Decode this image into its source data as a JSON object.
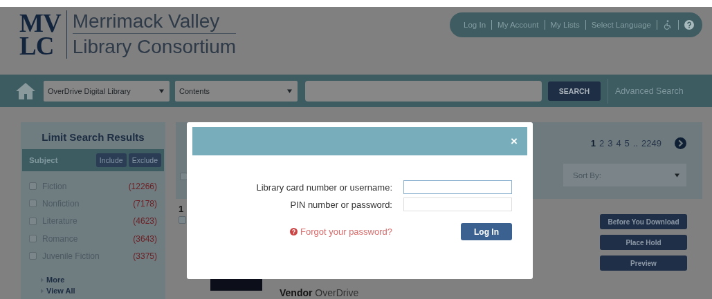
{
  "header": {
    "logo_letters": [
      "MV",
      "LC"
    ],
    "logo_name": [
      "Merrimack Valley",
      "Library Consortium"
    ]
  },
  "top_links": [
    "Log In",
    "My Account",
    "My Lists",
    "Select Language"
  ],
  "search_bar": {
    "library_select": "OverDrive Digital Library",
    "scope_select": "Contents",
    "search_button": "SEARCH",
    "advanced_link": "Advanced Search"
  },
  "sidebar": {
    "title": "Limit Search Results",
    "facet": "Subject",
    "buttons": [
      "Include",
      "Exclude"
    ],
    "items": [
      {
        "label": "Fiction",
        "count": "(12266)",
        "checked": false
      },
      {
        "label": "Nonfiction",
        "count": "(7178)",
        "checked": false
      },
      {
        "label": "Literature",
        "count": "(4623)",
        "checked": false
      },
      {
        "label": "Romance",
        "count": "(3643)",
        "checked": false
      },
      {
        "label": "Juvenile Fiction",
        "count": "(3375)",
        "checked": false
      }
    ],
    "links": [
      "More",
      "View All"
    ]
  },
  "results": {
    "pages": [
      {
        "label": "1",
        "selected": true
      },
      {
        "label": "2",
        "selected": false
      },
      {
        "label": "3",
        "selected": false
      },
      {
        "label": "4",
        "selected": false
      },
      {
        "label": "5",
        "selected": false
      }
    ],
    "gap": "..",
    "last_page": "2249",
    "sort": "Sort By:",
    "select_all_checked": false,
    "result_number": "1",
    "result_checked": false,
    "actions": [
      "Before You Download",
      "Place Hold",
      "Preview"
    ],
    "vendor": {
      "label": "Vendor",
      "value": "OverDrive"
    }
  },
  "dialog": {
    "close": "×",
    "fields": [
      {
        "label": "Library card number or username:",
        "focused": true
      },
      {
        "label": "PIN number or password:",
        "focused": false
      }
    ],
    "forgot_link": "Forgot your password?",
    "submit": "Log In"
  }
}
